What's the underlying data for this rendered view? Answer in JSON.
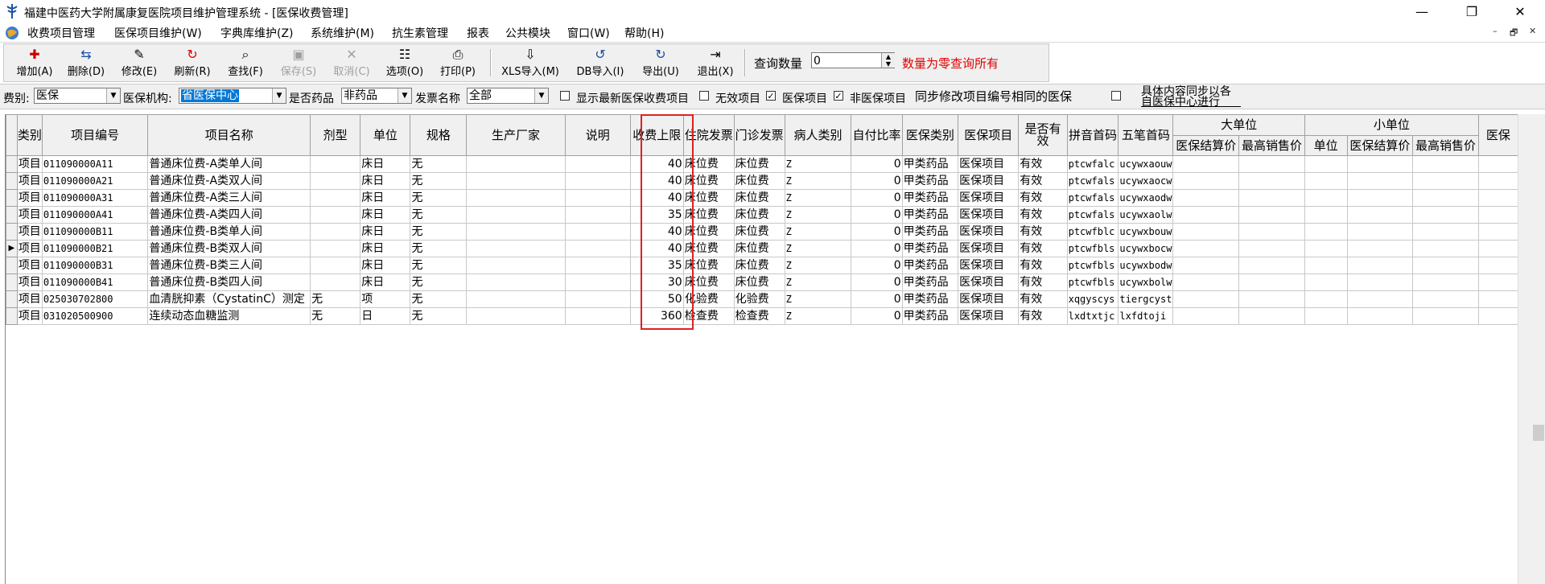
{
  "window": {
    "title": "福建中医药大学附属康复医院项目维护管理系统 - [医保收费管理]",
    "minimize": "—",
    "restore": "❐",
    "close": "✕"
  },
  "menu": {
    "items": [
      "收费项目管理",
      "医保项目维护(W)",
      "字典库维护(Z)",
      "系统维护(M)",
      "抗生素管理",
      "报表",
      "公共模块",
      "窗口(W)",
      "帮助(H)"
    ],
    "mdi": [
      "–",
      "🗗",
      "✕"
    ]
  },
  "toolbar": {
    "buttons": [
      {
        "label": "增加(A)",
        "icon": "add-icon",
        "glyph": "✚"
      },
      {
        "label": "删除(D)",
        "icon": "delete-icon",
        "glyph": "⇆"
      },
      {
        "label": "修改(E)",
        "icon": "edit-icon",
        "glyph": "✎"
      },
      {
        "label": "刷新(R)",
        "icon": "refresh-icon",
        "glyph": "↻"
      },
      {
        "label": "查找(F)",
        "icon": "binoculars-icon",
        "glyph": "⌕"
      },
      {
        "label": "保存(S)",
        "icon": "save-icon",
        "glyph": "▣"
      },
      {
        "label": "取消(C)",
        "icon": "cancel-icon",
        "glyph": "✕"
      },
      {
        "label": "选项(O)",
        "icon": "options-icon",
        "glyph": "☷"
      },
      {
        "label": "打印(P)",
        "icon": "printer-icon",
        "glyph": "⎙"
      },
      {
        "label": "XLS导入(M)",
        "icon": "xls-import-icon",
        "glyph": "⇩"
      },
      {
        "label": "DB导入(I)",
        "icon": "db-import-icon",
        "glyph": "↺"
      },
      {
        "label": "导出(U)",
        "icon": "export-icon",
        "glyph": "↻"
      },
      {
        "label": "退出(X)",
        "icon": "exit-icon",
        "glyph": "⇥"
      }
    ],
    "query_label": "查询数量",
    "query_value": "0",
    "query_hint": "数量为零查询所有",
    "hint_color": "#e00000"
  },
  "filters": {
    "fee_type_label": "费别:",
    "fee_type_value": "医保",
    "org_label": "医保机构:",
    "org_value": "省医保中心",
    "is_drug_label": "是否药品",
    "is_drug_value": "非药品",
    "invoice_label": "发票名称",
    "invoice_value": "全部",
    "show_latest_label": "显示最新医保收费项目",
    "invalid_label": "无效项目",
    "ins_item_label": "医保项目",
    "non_ins_label": "非医保项目",
    "sync_label": "同步修改项目编号相同的医保",
    "note_line1": "具体内容同步以各",
    "note_line2": "自医保中心进行",
    "checkmark": "✓"
  },
  "grid": {
    "columns": [
      "类别",
      "项目编号",
      "项目名称",
      "剂型",
      "单位",
      "规格",
      "生产厂家",
      "说明",
      "收费上限",
      "住院发票",
      "门诊发票",
      "病人类别",
      "自付比率",
      "医保类别",
      "医保项目",
      "是否有效",
      "拼音首码",
      "五笔首码",
      "大单位",
      "小单位",
      "医保"
    ],
    "subcolumns": [
      "医保结算价",
      "最高销售价",
      "单位",
      "医保结算价",
      "最高销售价"
    ],
    "current_row_marker": "▶",
    "rows": [
      {
        "cat": "项目",
        "code": "011090000A11",
        "name": "普通床位费-A类单人间",
        "form": "",
        "unit": "床日",
        "spec": "无",
        "mfr": "",
        "note": "",
        "limit": "40",
        "inp": "床位费",
        "outp": "床位费",
        "pt": "Z",
        "ratio": "0",
        "ins_cat": "甲类药品",
        "ins_item": "医保项目",
        "valid": "有效",
        "py": "ptcwfalc",
        "wb": "ucywxaouw"
      },
      {
        "cat": "项目",
        "code": "011090000A21",
        "name": "普通床位费-A类双人间",
        "form": "",
        "unit": "床日",
        "spec": "无",
        "mfr": "",
        "note": "",
        "limit": "40",
        "inp": "床位费",
        "outp": "床位费",
        "pt": "Z",
        "ratio": "0",
        "ins_cat": "甲类药品",
        "ins_item": "医保项目",
        "valid": "有效",
        "py": "ptcwfals",
        "wb": "ucywxaocw"
      },
      {
        "cat": "项目",
        "code": "011090000A31",
        "name": "普通床位费-A类三人间",
        "form": "",
        "unit": "床日",
        "spec": "无",
        "mfr": "",
        "note": "",
        "limit": "40",
        "inp": "床位费",
        "outp": "床位费",
        "pt": "Z",
        "ratio": "0",
        "ins_cat": "甲类药品",
        "ins_item": "医保项目",
        "valid": "有效",
        "py": "ptcwfals",
        "wb": "ucywxaodw"
      },
      {
        "cat": "项目",
        "code": "011090000A41",
        "name": "普通床位费-A类四人间",
        "form": "",
        "unit": "床日",
        "spec": "无",
        "mfr": "",
        "note": "",
        "limit": "35",
        "inp": "床位费",
        "outp": "床位费",
        "pt": "Z",
        "ratio": "0",
        "ins_cat": "甲类药品",
        "ins_item": "医保项目",
        "valid": "有效",
        "py": "ptcwfals",
        "wb": "ucywxaolw"
      },
      {
        "cat": "项目",
        "code": "011090000B11",
        "name": "普通床位费-B类单人间",
        "form": "",
        "unit": "床日",
        "spec": "无",
        "mfr": "",
        "note": "",
        "limit": "40",
        "inp": "床位费",
        "outp": "床位费",
        "pt": "Z",
        "ratio": "0",
        "ins_cat": "甲类药品",
        "ins_item": "医保项目",
        "valid": "有效",
        "py": "ptcwfblc",
        "wb": "ucywxbouw"
      },
      {
        "cat": "项目",
        "code": "011090000B21",
        "name": "普通床位费-B类双人间",
        "form": "",
        "unit": "床日",
        "spec": "无",
        "mfr": "",
        "note": "",
        "limit": "40",
        "inp": "床位费",
        "outp": "床位费",
        "pt": "Z",
        "ratio": "0",
        "ins_cat": "甲类药品",
        "ins_item": "医保项目",
        "valid": "有效",
        "py": "ptcwfbls",
        "wb": "ucywxbocw"
      },
      {
        "cat": "项目",
        "code": "011090000B31",
        "name": "普通床位费-B类三人间",
        "form": "",
        "unit": "床日",
        "spec": "无",
        "mfr": "",
        "note": "",
        "limit": "35",
        "inp": "床位费",
        "outp": "床位费",
        "pt": "Z",
        "ratio": "0",
        "ins_cat": "甲类药品",
        "ins_item": "医保项目",
        "valid": "有效",
        "py": "ptcwfbls",
        "wb": "ucywxbodw"
      },
      {
        "cat": "项目",
        "code": "011090000B41",
        "name": "普通床位费-B类四人间",
        "form": "",
        "unit": "床日",
        "spec": "无",
        "mfr": "",
        "note": "",
        "limit": "30",
        "inp": "床位费",
        "outp": "床位费",
        "pt": "Z",
        "ratio": "0",
        "ins_cat": "甲类药品",
        "ins_item": "医保项目",
        "valid": "有效",
        "py": "ptcwfbls",
        "wb": "ucywxbolw"
      },
      {
        "cat": "项目",
        "code": "025030702800",
        "name": "血清胱抑素（CystatinC）测定",
        "form": "无",
        "unit": "项",
        "spec": "无",
        "mfr": "",
        "note": "",
        "limit": "50",
        "inp": "化验费",
        "outp": "化验费",
        "pt": "Z",
        "ratio": "0",
        "ins_cat": "甲类药品",
        "ins_item": "医保项目",
        "valid": "有效",
        "py": "xqgyscys",
        "wb": "tiergcyst"
      },
      {
        "cat": "项目",
        "code": "031020500900",
        "name": "连续动态血糖监测",
        "form": "无",
        "unit": "日",
        "spec": "无",
        "mfr": "",
        "note": "",
        "limit": "360",
        "inp": "检查费",
        "outp": "检查费",
        "pt": "Z",
        "ratio": "0",
        "ins_cat": "甲类药品",
        "ins_item": "医保项目",
        "valid": "有效",
        "py": "lxdtxtjc",
        "wb": "lxfdtoji"
      }
    ],
    "current_row_index": 5,
    "highlight_color": "#e02020"
  }
}
